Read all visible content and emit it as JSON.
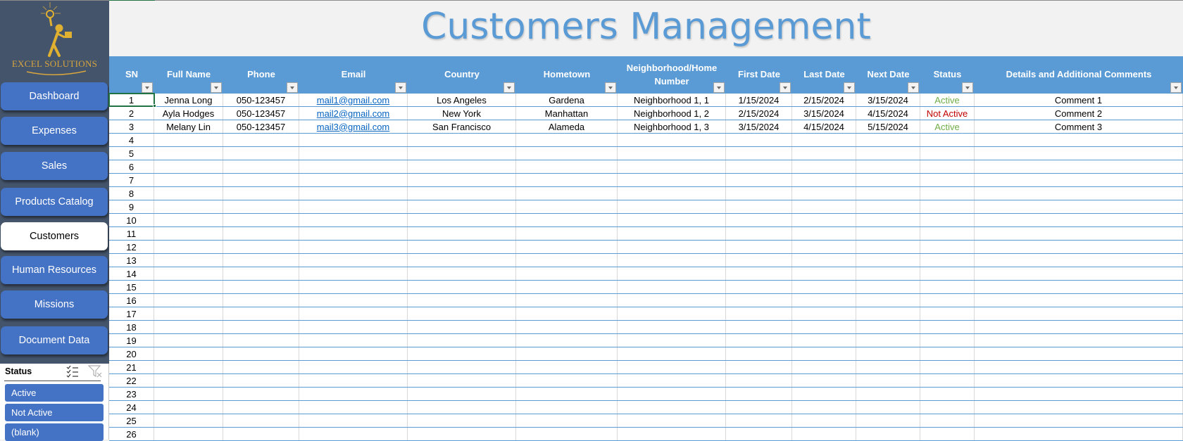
{
  "logo": {
    "name": "EXCEL SOLUTIONS",
    "icon": "person-with-lightbulb-icon",
    "color": "#d8a53f"
  },
  "sidebar": {
    "items": [
      {
        "label": "Dashboard",
        "active": false
      },
      {
        "label": "Expenses",
        "active": false
      },
      {
        "label": "Sales",
        "active": false
      },
      {
        "label": "Products Catalog",
        "active": false
      },
      {
        "label": "Customers",
        "active": true
      },
      {
        "label": "Human Resources",
        "active": false
      },
      {
        "label": "Missions",
        "active": false
      },
      {
        "label": "Document Data",
        "active": false
      }
    ]
  },
  "slicer": {
    "title": "Status",
    "multi_select_icon": "multi-select-icon",
    "clear_filter_icon": "clear-filter-icon",
    "items": [
      "Active",
      "Not Active",
      "(blank)"
    ]
  },
  "page": {
    "title": "Customers Management"
  },
  "colors": {
    "accent": "#5b9bd5",
    "sidebar_bg": "#44546a",
    "button": "#4472c4",
    "status_active": "#70ad47",
    "status_not_active": "#c00000",
    "link": "#0563c1"
  },
  "table": {
    "columns": [
      "SN",
      "Full Name",
      "Phone",
      "Email",
      "Country",
      "Hometown",
      "Neighborhood/Home Number",
      "First Date",
      "Last Date",
      "Next Date",
      "Status",
      "Details and Additional Comments"
    ],
    "rows": [
      [
        "1",
        "Jenna Long",
        "050-123457",
        "mail1@gmail.com",
        "Los Angeles",
        "Gardena",
        "Neighborhood 1, 1",
        "1/15/2024",
        "2/15/2024",
        "3/15/2024",
        "Active",
        "Comment 1"
      ],
      [
        "2",
        "Ayla Hodges",
        "050-123457",
        "mail2@gmail.com",
        "New York",
        "Manhattan",
        "Neighborhood 1, 2",
        "2/15/2024",
        "3/15/2024",
        "4/15/2024",
        "Not Active",
        "Comment 2"
      ],
      [
        "3",
        "Melany Lin",
        "050-123457",
        "mail3@gmail.com",
        "San Francisco",
        "Alameda",
        "Neighborhood 1, 3",
        "3/15/2024",
        "4/15/2024",
        "5/15/2024",
        "Active",
        "Comment 3"
      ],
      [
        "4",
        "",
        "",
        "",
        "",
        "",
        "",
        "",
        "",
        "",
        "",
        ""
      ],
      [
        "5",
        "",
        "",
        "",
        "",
        "",
        "",
        "",
        "",
        "",
        "",
        ""
      ],
      [
        "6",
        "",
        "",
        "",
        "",
        "",
        "",
        "",
        "",
        "",
        "",
        ""
      ],
      [
        "7",
        "",
        "",
        "",
        "",
        "",
        "",
        "",
        "",
        "",
        "",
        ""
      ],
      [
        "8",
        "",
        "",
        "",
        "",
        "",
        "",
        "",
        "",
        "",
        "",
        ""
      ],
      [
        "9",
        "",
        "",
        "",
        "",
        "",
        "",
        "",
        "",
        "",
        "",
        ""
      ],
      [
        "10",
        "",
        "",
        "",
        "",
        "",
        "",
        "",
        "",
        "",
        "",
        ""
      ],
      [
        "11",
        "",
        "",
        "",
        "",
        "",
        "",
        "",
        "",
        "",
        "",
        ""
      ],
      [
        "12",
        "",
        "",
        "",
        "",
        "",
        "",
        "",
        "",
        "",
        "",
        ""
      ],
      [
        "13",
        "",
        "",
        "",
        "",
        "",
        "",
        "",
        "",
        "",
        "",
        ""
      ],
      [
        "14",
        "",
        "",
        "",
        "",
        "",
        "",
        "",
        "",
        "",
        "",
        ""
      ],
      [
        "15",
        "",
        "",
        "",
        "",
        "",
        "",
        "",
        "",
        "",
        "",
        ""
      ],
      [
        "16",
        "",
        "",
        "",
        "",
        "",
        "",
        "",
        "",
        "",
        "",
        ""
      ],
      [
        "17",
        "",
        "",
        "",
        "",
        "",
        "",
        "",
        "",
        "",
        "",
        ""
      ],
      [
        "18",
        "",
        "",
        "",
        "",
        "",
        "",
        "",
        "",
        "",
        "",
        ""
      ],
      [
        "19",
        "",
        "",
        "",
        "",
        "",
        "",
        "",
        "",
        "",
        "",
        ""
      ],
      [
        "20",
        "",
        "",
        "",
        "",
        "",
        "",
        "",
        "",
        "",
        "",
        ""
      ],
      [
        "21",
        "",
        "",
        "",
        "",
        "",
        "",
        "",
        "",
        "",
        "",
        ""
      ],
      [
        "22",
        "",
        "",
        "",
        "",
        "",
        "",
        "",
        "",
        "",
        "",
        ""
      ],
      [
        "23",
        "",
        "",
        "",
        "",
        "",
        "",
        "",
        "",
        "",
        "",
        ""
      ],
      [
        "24",
        "",
        "",
        "",
        "",
        "",
        "",
        "",
        "",
        "",
        "",
        ""
      ],
      [
        "25",
        "",
        "",
        "",
        "",
        "",
        "",
        "",
        "",
        "",
        "",
        ""
      ],
      [
        "26",
        "",
        "",
        "",
        "",
        "",
        "",
        "",
        "",
        "",
        "",
        ""
      ]
    ]
  }
}
